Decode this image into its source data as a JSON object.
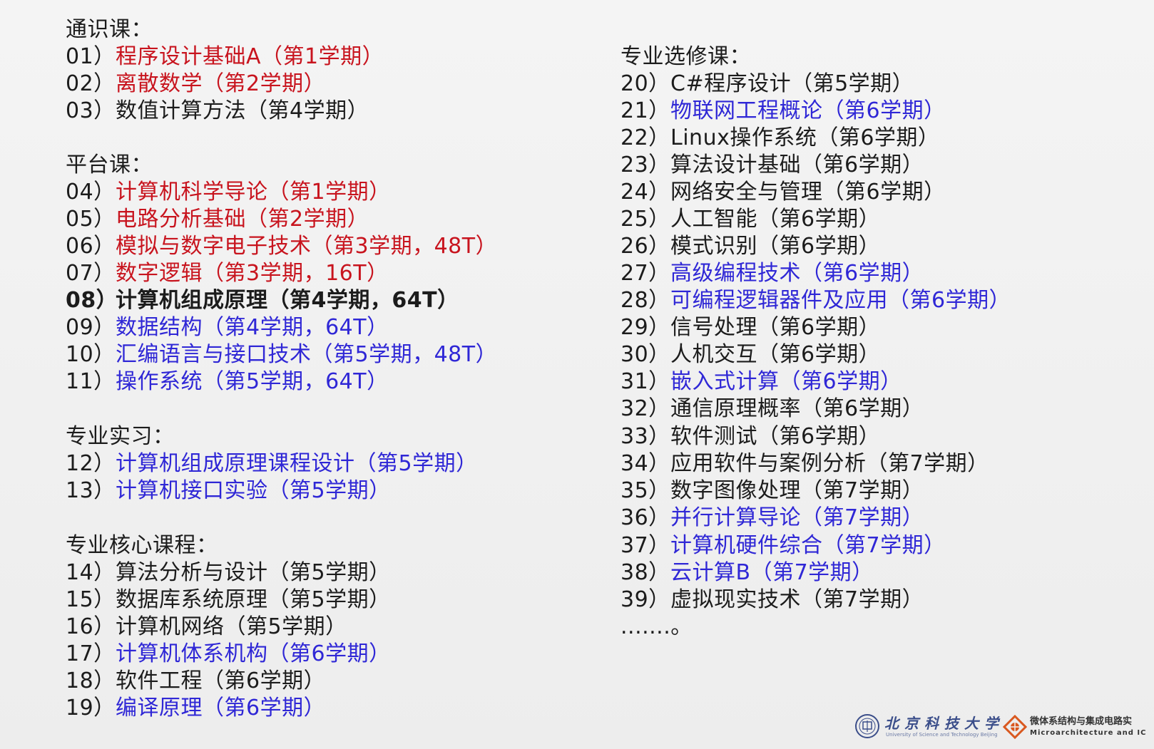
{
  "sections_left": [
    {
      "heading": "通识课：",
      "courses": [
        {
          "num": "01）",
          "name": "程序设计基础A（第1学期）",
          "color": "red"
        },
        {
          "num": "02）",
          "name": "离散数学（第2学期）",
          "color": "red"
        },
        {
          "num": "03）",
          "name": "数值计算方法（第4学期）",
          "color": "black"
        }
      ]
    },
    {
      "heading": "平台课：",
      "courses": [
        {
          "num": "04）",
          "name": "计算机科学导论（第1学期）",
          "color": "red"
        },
        {
          "num": "05）",
          "name": "电路分析基础（第2学期）",
          "color": "red"
        },
        {
          "num": "06）",
          "name": "模拟与数字电子技术（第3学期，48T）",
          "color": "red"
        },
        {
          "num": "07）",
          "name": "数字逻辑（第3学期，16T）",
          "color": "red"
        },
        {
          "num": "08）",
          "name": "计算机组成原理（第4学期，64T）",
          "color": "black",
          "bold": true
        },
        {
          "num": "09）",
          "name": "数据结构（第4学期，64T）",
          "color": "blue"
        },
        {
          "num": "10）",
          "name": "汇编语言与接口技术（第5学期，48T）",
          "color": "blue"
        },
        {
          "num": "11）",
          "name": "操作系统（第5学期，64T）",
          "color": "blue"
        }
      ]
    },
    {
      "heading": "专业实习：",
      "courses": [
        {
          "num": "12）",
          "name": "计算机组成原理课程设计（第5学期）",
          "color": "blue"
        },
        {
          "num": "13）",
          "name": "计算机接口实验（第5学期）",
          "color": "blue"
        }
      ]
    },
    {
      "heading": "专业核心课程：",
      "courses": [
        {
          "num": "14）",
          "name": "算法分析与设计（第5学期）",
          "color": "black"
        },
        {
          "num": "15）",
          "name": "数据库系统原理（第5学期）",
          "color": "black"
        },
        {
          "num": "16）",
          "name": "计算机网络（第5学期）",
          "color": "black"
        },
        {
          "num": "17）",
          "name": "计算机体系机构（第6学期）",
          "color": "blue"
        },
        {
          "num": "18）",
          "name": "软件工程（第6学期）",
          "color": "black"
        },
        {
          "num": "19）",
          "name": "编译原理（第6学期）",
          "color": "blue"
        }
      ]
    }
  ],
  "sections_right": [
    {
      "heading": "专业选修课：",
      "courses": [
        {
          "num": "20）",
          "name": "C#程序设计（第5学期）",
          "color": "black"
        },
        {
          "num": "21）",
          "name": "物联网工程概论（第6学期）",
          "color": "blue"
        },
        {
          "num": "22）",
          "name": "Linux操作系统（第6学期）",
          "color": "black"
        },
        {
          "num": "23）",
          "name": "算法设计基础（第6学期）",
          "color": "black"
        },
        {
          "num": "24）",
          "name": "网络安全与管理（第6学期）",
          "color": "black"
        },
        {
          "num": "25）",
          "name": "人工智能（第6学期）",
          "color": "black"
        },
        {
          "num": "26）",
          "name": "模式识别（第6学期）",
          "color": "black"
        },
        {
          "num": "27）",
          "name": "高级编程技术（第6学期）",
          "color": "blue"
        },
        {
          "num": "28）",
          "name": "可编程逻辑器件及应用（第6学期）",
          "color": "blue"
        },
        {
          "num": "29）",
          "name": "信号处理（第6学期）",
          "color": "black"
        },
        {
          "num": "30）",
          "name": "人机交互（第6学期）",
          "color": "black"
        },
        {
          "num": "31）",
          "name": "嵌入式计算（第6学期）",
          "color": "blue"
        },
        {
          "num": "32）",
          "name": "通信原理概率（第6学期）",
          "color": "black"
        },
        {
          "num": "33）",
          "name": "软件测试（第6学期）",
          "color": "black"
        },
        {
          "num": "34）",
          "name": "应用软件与案例分析（第7学期）",
          "color": "black"
        },
        {
          "num": "35）",
          "name": "数字图像处理（第7学期）",
          "color": "black"
        },
        {
          "num": "36）",
          "name": "并行计算导论（第7学期）",
          "color": "blue"
        },
        {
          "num": "37）",
          "name": "计算机硬件综合（第7学期）",
          "color": "blue"
        },
        {
          "num": "38）",
          "name": "云计算B（第7学期）",
          "color": "blue"
        },
        {
          "num": "39）",
          "name": "虚拟现实技术（第7学期）",
          "color": "black"
        }
      ]
    }
  ],
  "ellipsis": ".......。",
  "logos": {
    "university_name": "北京科技大学",
    "university_sub": "University of Science and Technology Beijing",
    "lab_name": "微体系结构与集成电路实",
    "lab_sub": "Microarchitecture and IC"
  },
  "colors": {
    "red": "#c8141e",
    "blue": "#2f27d6",
    "black": "#1c1c1c",
    "background": "#efefef"
  }
}
